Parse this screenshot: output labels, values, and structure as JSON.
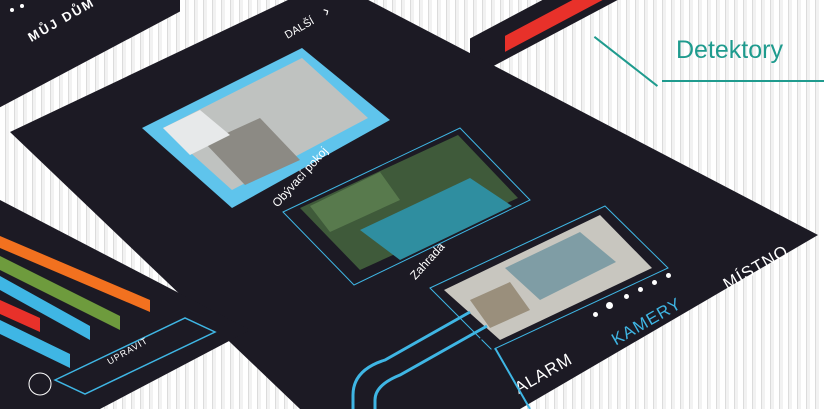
{
  "header": {
    "title": "MŮJ DŮM",
    "next_label": "DALŠÍ"
  },
  "cameras": [
    {
      "label": "Obývací pokoj",
      "selected": true
    },
    {
      "label": "Zahrada",
      "selected": false
    },
    {
      "label": "",
      "selected": false
    }
  ],
  "nav": {
    "alarm": "ALARM",
    "cameras": "KAMERY",
    "rooms": "MÍSTNO"
  },
  "left_panel": {
    "edit_button": "UPRAVIT"
  },
  "callout": {
    "detectors": "Detektory"
  },
  "colors": {
    "panel": "#1c1a24",
    "accent": "#3fb6e4",
    "alert": "#e8312a",
    "callout": "#1f9b8e"
  }
}
